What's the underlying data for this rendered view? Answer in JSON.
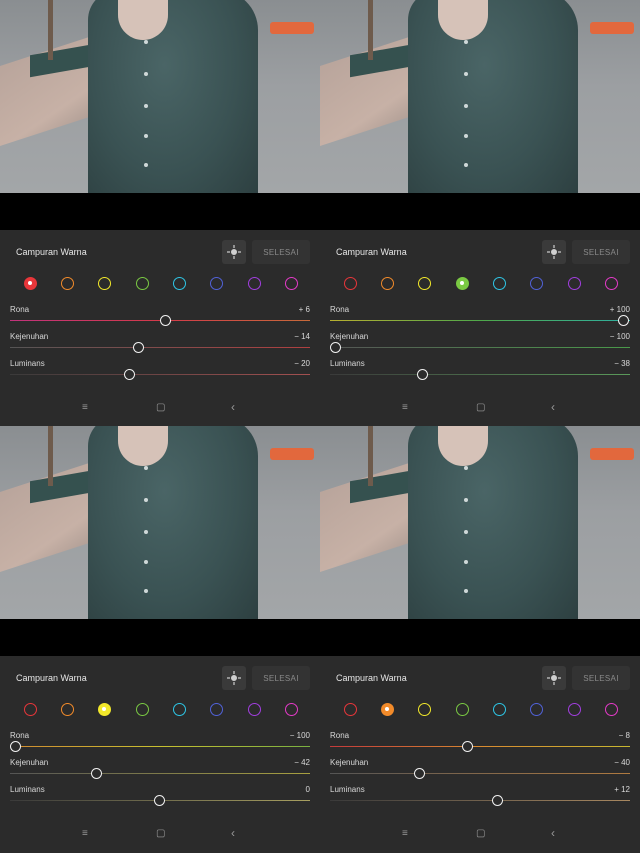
{
  "panels": [
    {
      "title": "Campuran Warna",
      "done_label": "SELESAI",
      "selected_color": "red",
      "rows": [
        {
          "label": "Rona",
          "value": "+ 6",
          "level": 0.52
        },
        {
          "label": "Kejenuhan",
          "value": "− 14",
          "level": 0.43
        },
        {
          "label": "Luminans",
          "value": "− 20",
          "level": 0.4
        }
      ]
    },
    {
      "title": "Campuran Warna",
      "done_label": "SELESAI",
      "selected_color": "green",
      "rows": [
        {
          "label": "Rona",
          "value": "+ 100",
          "level": 1.0
        },
        {
          "label": "Kejenuhan",
          "value": "− 100",
          "level": 0.0
        },
        {
          "label": "Luminans",
          "value": "− 38",
          "level": 0.31
        }
      ]
    },
    {
      "title": "Campuran Warna",
      "done_label": "SELESAI",
      "selected_color": "yellow",
      "rows": [
        {
          "label": "Rona",
          "value": "− 100",
          "level": 0.0
        },
        {
          "label": "Kejenuhan",
          "value": "− 42",
          "level": 0.29
        },
        {
          "label": "Luminans",
          "value": "0",
          "level": 0.5
        }
      ]
    },
    {
      "title": "Campuran Warna",
      "done_label": "SELESAI",
      "selected_color": "orange",
      "rows": [
        {
          "label": "Rona",
          "value": "− 8",
          "level": 0.46
        },
        {
          "label": "Kejenuhan",
          "value": "− 40",
          "level": 0.3
        },
        {
          "label": "Luminans",
          "value": "+ 12",
          "level": 0.56
        }
      ]
    }
  ],
  "colors": [
    {
      "name": "red",
      "hex": "#e8363a"
    },
    {
      "name": "orange",
      "hex": "#f28b2a"
    },
    {
      "name": "yellow",
      "hex": "#f2e82a"
    },
    {
      "name": "green",
      "hex": "#7ac943"
    },
    {
      "name": "aqua",
      "hex": "#2ec6e6"
    },
    {
      "name": "blue",
      "hex": "#5162d8"
    },
    {
      "name": "purple",
      "hex": "#a23ee0"
    },
    {
      "name": "magenta",
      "hex": "#e43ac8"
    }
  ],
  "icons": {
    "target": "target-adjust-icon",
    "nav_menu": "menu-icon",
    "nav_home": "home-icon",
    "nav_back": "back-icon"
  },
  "nav_glyphs": {
    "menu": "≡",
    "home": "▢",
    "back": "‹"
  }
}
